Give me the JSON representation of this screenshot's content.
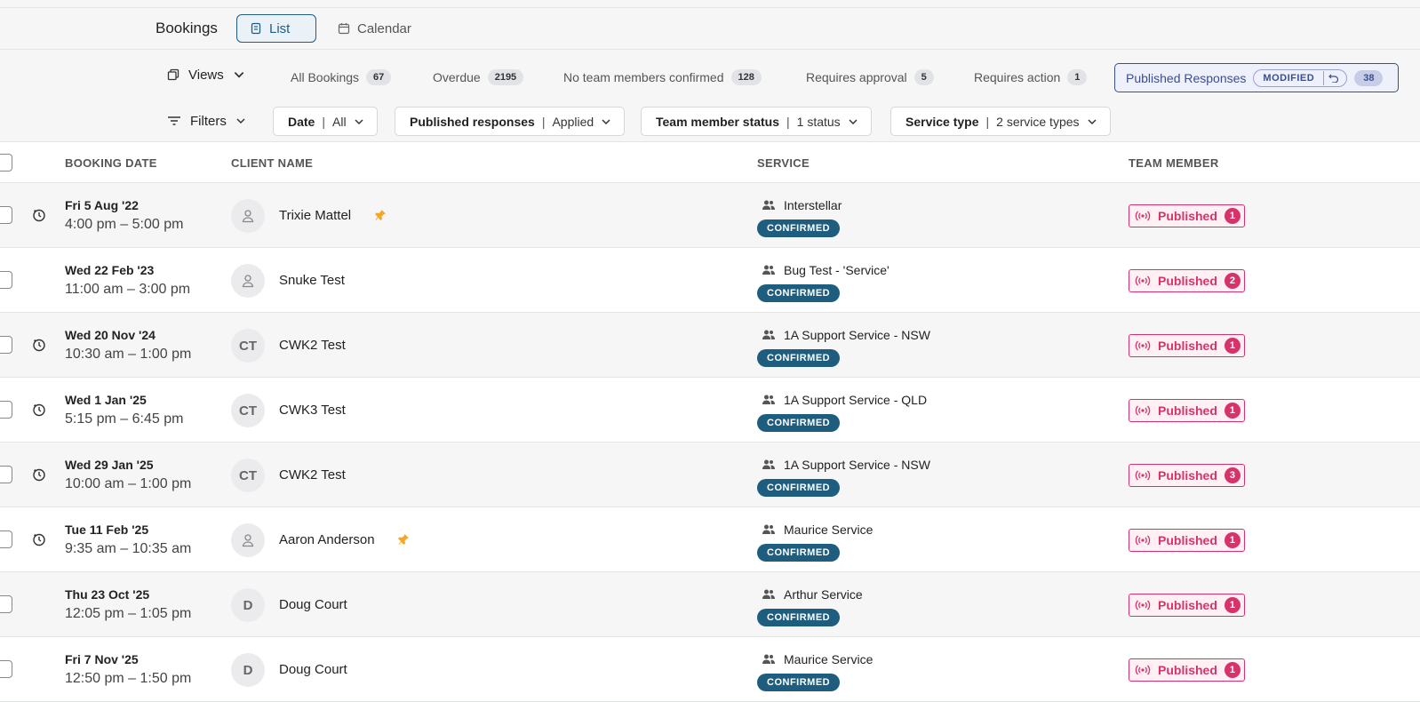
{
  "header": {
    "title": "Bookings",
    "tabs": [
      {
        "label": "List",
        "active": true
      },
      {
        "label": "Calendar",
        "active": false
      }
    ]
  },
  "toolbar": {
    "views_label": "Views",
    "segments": [
      {
        "label": "All Bookings",
        "count": "67"
      },
      {
        "label": "Overdue",
        "count": "2195"
      },
      {
        "label": "No team members confirmed",
        "count": "128"
      },
      {
        "label": "Requires approval",
        "count": "5"
      },
      {
        "label": "Requires action",
        "count": "1"
      }
    ],
    "active_segment": {
      "label": "Published Responses",
      "badge": "MODIFIED",
      "count": "38"
    },
    "filters_label": "Filters",
    "filters": [
      {
        "name": "Date",
        "value": "All"
      },
      {
        "name": "Published responses",
        "value": "Applied"
      },
      {
        "name": "Team member status",
        "value": "1 status"
      },
      {
        "name": "Service type",
        "value": "2 service types"
      }
    ]
  },
  "table": {
    "columns": [
      "BOOKING DATE",
      "CLIENT NAME",
      "SERVICE",
      "TEAM MEMBER"
    ],
    "rows": [
      {
        "date": "Fri 5 Aug '22",
        "time": "4:00 pm – 5:00 pm",
        "clock": true,
        "avatar": "",
        "client": "Trixie Mattel",
        "pinned": true,
        "service": "Interstellar",
        "status": "CONFIRMED",
        "team": "Published",
        "team_count": "1"
      },
      {
        "date": "Wed 22 Feb '23",
        "time": "11:00 am – 3:00 pm",
        "clock": false,
        "avatar": "",
        "client": "Snuke Test",
        "pinned": false,
        "service": "Bug Test - 'Service'",
        "status": "CONFIRMED",
        "team": "Published",
        "team_count": "2"
      },
      {
        "date": "Wed 20 Nov '24",
        "time": "10:30 am – 1:00 pm",
        "clock": true,
        "avatar": "CT",
        "client": "CWK2 Test",
        "pinned": false,
        "service": "1A Support Service - NSW",
        "status": "CONFIRMED",
        "team": "Published",
        "team_count": "1"
      },
      {
        "date": "Wed 1 Jan '25",
        "time": "5:15 pm – 6:45 pm",
        "clock": true,
        "avatar": "CT",
        "client": "CWK3 Test",
        "pinned": false,
        "service": "1A Support Service - QLD",
        "status": "CONFIRMED",
        "team": "Published",
        "team_count": "1"
      },
      {
        "date": "Wed 29 Jan '25",
        "time": "10:00 am – 1:00 pm",
        "clock": true,
        "avatar": "CT",
        "client": "CWK2 Test",
        "pinned": false,
        "service": "1A Support Service - NSW",
        "status": "CONFIRMED",
        "team": "Published",
        "team_count": "3"
      },
      {
        "date": "Tue 11 Feb '25",
        "time": "9:35 am – 10:35 am",
        "clock": true,
        "avatar": "",
        "client": "Aaron Anderson",
        "pinned": true,
        "service": "Maurice Service",
        "status": "CONFIRMED",
        "team": "Published",
        "team_count": "1"
      },
      {
        "date": "Thu 23 Oct '25",
        "time": "12:05 pm – 1:05 pm",
        "clock": false,
        "avatar": "D",
        "client": "Doug Court",
        "pinned": false,
        "service": "Arthur Service",
        "status": "CONFIRMED",
        "team": "Published",
        "team_count": "1"
      },
      {
        "date": "Fri 7 Nov '25",
        "time": "12:50 pm – 1:50 pm",
        "clock": false,
        "avatar": "D",
        "client": "Doug Court",
        "pinned": false,
        "service": "Maurice Service",
        "status": "CONFIRMED",
        "team": "Published",
        "team_count": "1"
      }
    ]
  },
  "colors": {
    "accent": "#1f5d86",
    "published": "#d6336c",
    "confirmed": "#1f5d7f",
    "pin": "#f5a623"
  }
}
